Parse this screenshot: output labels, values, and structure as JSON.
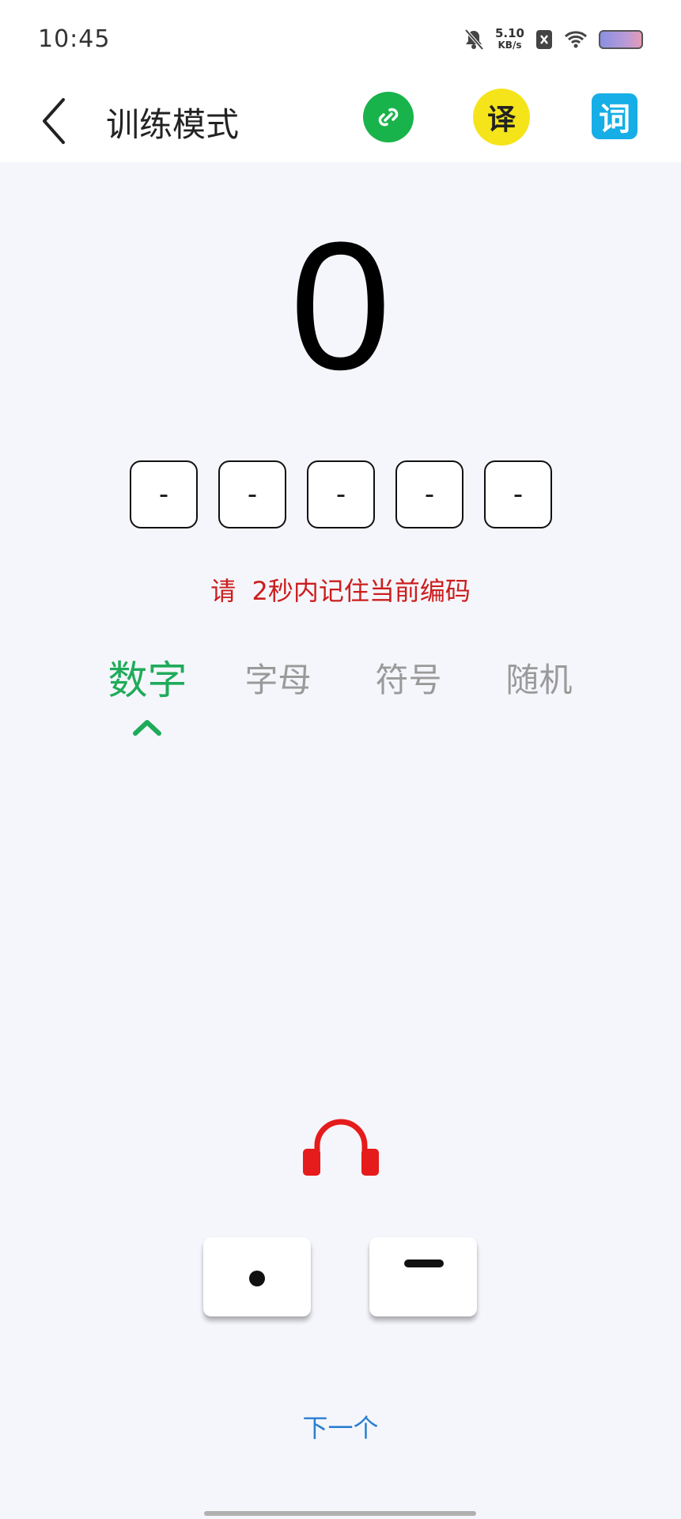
{
  "status_bar": {
    "time": "10:45",
    "net_speed_value": "5.10",
    "net_speed_unit": "KB/s"
  },
  "app_bar": {
    "title": "训练模式",
    "translate_label": "译",
    "dictionary_label": "词"
  },
  "score": "0",
  "code_slots": [
    "-",
    "-",
    "-",
    "-",
    "-"
  ],
  "hint": "请  2秒内记住当前编码",
  "tabs": [
    {
      "label": "数字",
      "active": true
    },
    {
      "label": "字母",
      "active": false
    },
    {
      "label": "符号",
      "active": false
    },
    {
      "label": "随机",
      "active": false
    }
  ],
  "next_label": "下一个",
  "colors": {
    "accent_green": "#1fab5a",
    "hint_red": "#cc1d1d",
    "link_blue": "#2a7fd0"
  }
}
